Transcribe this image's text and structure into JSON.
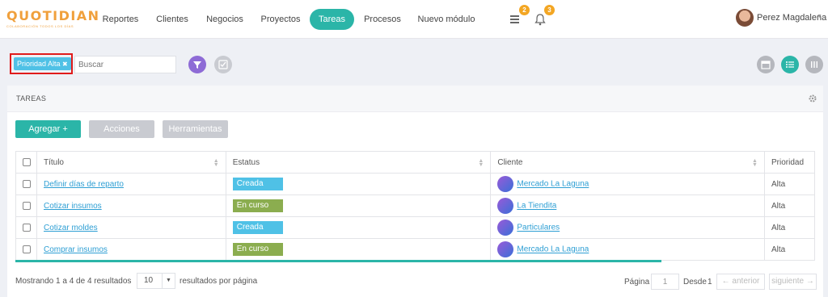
{
  "brand": {
    "logo": "QUOTIDIAN",
    "tagline": "COLABORACIÓN TODOS LOS DÍAS",
    "accent": "#2bb5a8",
    "logo_color": "#f0a03c"
  },
  "nav": {
    "items": [
      "Reportes",
      "Clientes",
      "Negocios",
      "Proyectos",
      "Tareas",
      "Procesos",
      "Nuevo módulo"
    ],
    "active": "Tareas",
    "list_badge": "2",
    "bell_badge": "3"
  },
  "user": {
    "name": "Perez Magdalena"
  },
  "filters": {
    "chip_label": "Prioridad Alta",
    "search_placeholder": "Buscar"
  },
  "panel": {
    "title": "TAREAS",
    "add_button": "Agregar +",
    "actions_button": "Acciones",
    "tools_button": "Herramientas"
  },
  "table": {
    "headers": [
      "Título",
      "Estatus",
      "Cliente",
      "Prioridad"
    ],
    "rows": [
      {
        "title": "Definir días de reparto",
        "status": "Creada",
        "client": "Mercado La Laguna",
        "priority": "Alta"
      },
      {
        "title": "Cotizar insumos",
        "status": "En curso",
        "client": "La Tiendita",
        "priority": "Alta"
      },
      {
        "title": "Cotizar moldes",
        "status": "Creada",
        "client": "Particulares",
        "priority": "Alta"
      },
      {
        "title": "Comprar insumos",
        "status": "En curso",
        "client": "Mercado La Laguna",
        "priority": "Alta"
      }
    ],
    "status_colors": {
      "Creada": "#4fc1e6",
      "En curso": "#8bad4f"
    }
  },
  "footer": {
    "summary": "Mostrando 1 a 4 de 4 resultados",
    "per_page_value": "10",
    "per_page_label": "resultados por página",
    "page_label": "Página",
    "page_value": "1",
    "of_label": "Desde",
    "total_pages": "1",
    "prev_label": "← anterior",
    "next_label": "siguiente →"
  }
}
